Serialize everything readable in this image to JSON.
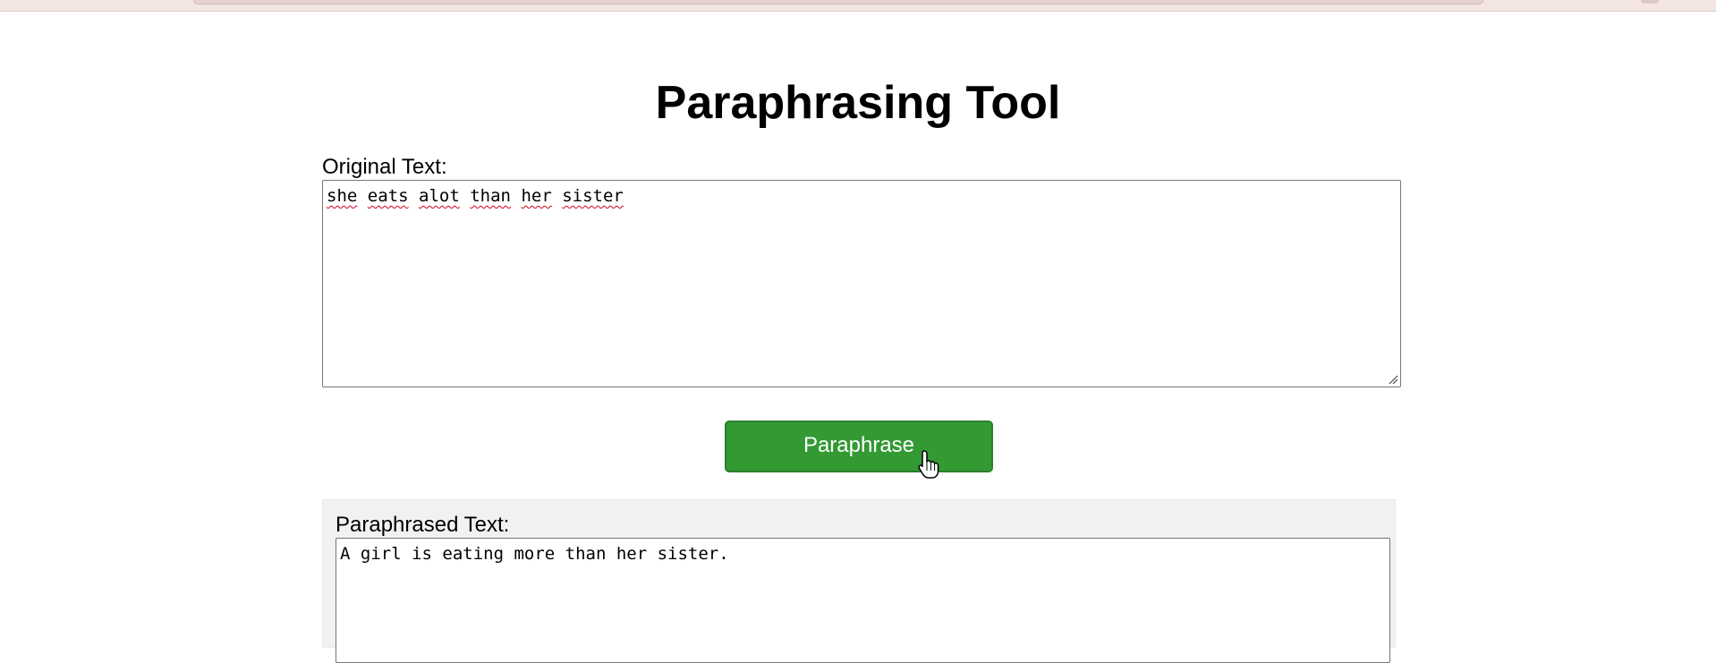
{
  "page": {
    "title": "Paraphrasing Tool"
  },
  "original": {
    "label": "Original Text:",
    "words": [
      "she",
      "eats",
      "alot",
      "than",
      "her",
      "sister"
    ]
  },
  "action": {
    "button_label": "Paraphrase"
  },
  "result": {
    "label": "Paraphrased Text:",
    "value": "A girl is eating more than her sister."
  },
  "colors": {
    "button_bg": "#339933",
    "panel_bg": "#f1f1f1",
    "spellcheck_underline": "#d0021b"
  },
  "icons": {
    "cursor": "hand-pointer-icon",
    "resize": "resize-grip-icon"
  }
}
